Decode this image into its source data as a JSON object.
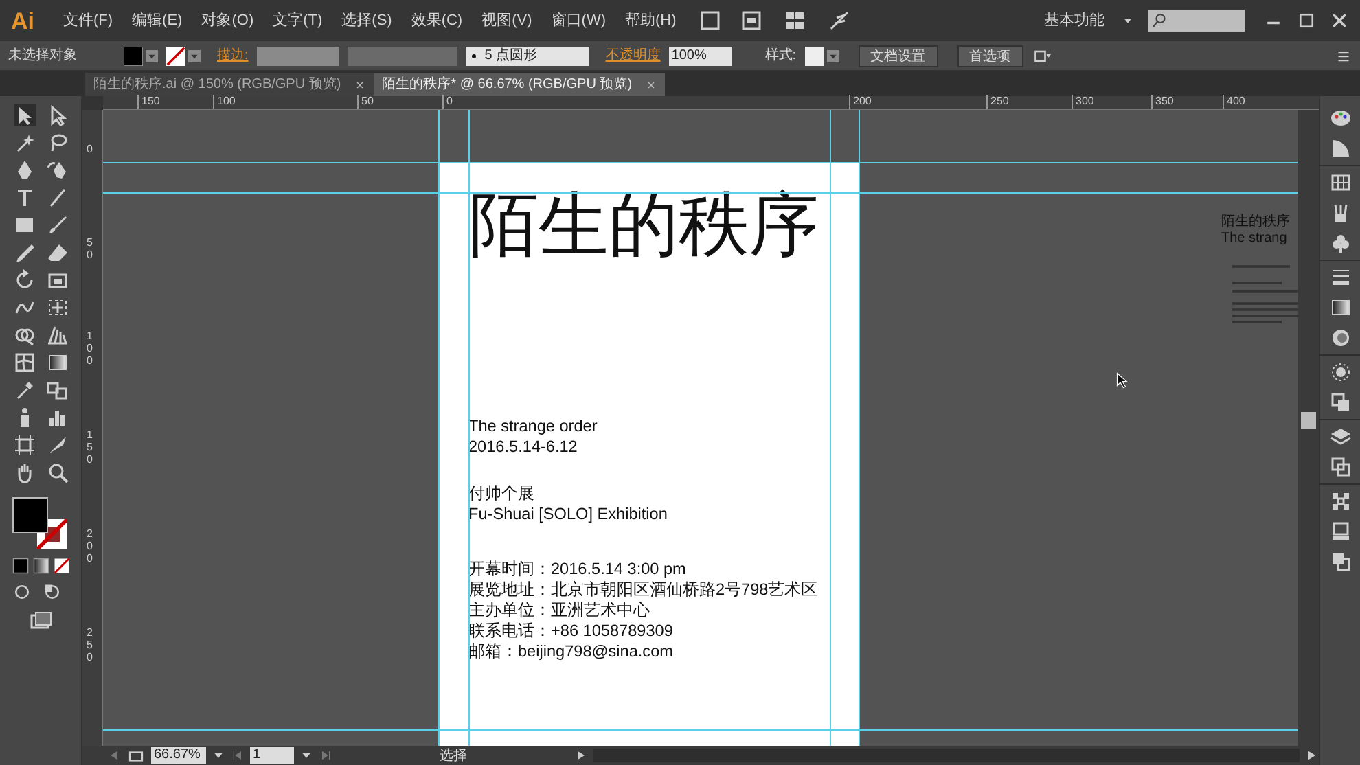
{
  "menu_bar": {
    "app": "Ai",
    "menus": [
      "文件(F)",
      "编辑(E)",
      "对象(O)",
      "文字(T)",
      "选择(S)",
      "效果(C)",
      "视图(V)",
      "窗口(W)",
      "帮助(H)"
    ],
    "workspace": "基本功能"
  },
  "control_bar": {
    "selection": "未选择对象",
    "stroke_label": "描边:",
    "brush": "5 点圆形",
    "opacity_label": "不透明度",
    "opacity": "100%",
    "style_label": "样式:",
    "buttons": [
      "文档设置",
      "首选项"
    ]
  },
  "tabs": [
    {
      "label": "陌生的秩序.ai @ 150% (RGB/GPU 预览)",
      "selected": false
    },
    {
      "label": "陌生的秩序* @ 66.67% (RGB/GPU 预览)",
      "selected": true
    }
  ],
  "ruler_h": [
    "150",
    "100",
    "50",
    "0",
    "200",
    "250",
    "300",
    "350",
    "400"
  ],
  "ruler_v": [
    "0",
    "50",
    "100",
    "150",
    "200",
    "250"
  ],
  "artboard": {
    "title": "陌生的秩序",
    "groups": [
      [
        "The strange order",
        "2016.5.14-6.12"
      ],
      [
        "付帅个展",
        "Fu-Shuai [SOLO] Exhibition"
      ],
      [
        "开幕时间：2016.5.14 3:00 pm",
        "展览地址：北京市朝阳区酒仙桥路2号798艺术区",
        "主办单位：亚洲艺术中心",
        "联系电话：+86 1058789309",
        "邮箱：beijing798@sina.com"
      ]
    ]
  },
  "side_object": {
    "lines": [
      "陌生的秩序",
      "The strang"
    ]
  },
  "status_bar": {
    "zoom": "66.67%",
    "artboard": "1",
    "tool": "选择"
  }
}
